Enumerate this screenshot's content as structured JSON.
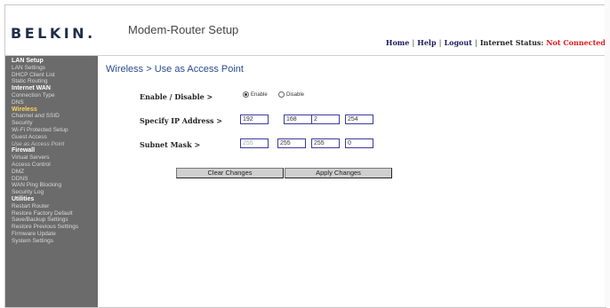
{
  "header": {
    "logo": "BELKIN.",
    "title": "Modem-Router Setup",
    "links": [
      "Home",
      "Help",
      "Logout"
    ],
    "status_label": "Internet Status:",
    "status_value": "Not Connected",
    "status_color": "#e01818"
  },
  "sidebar": {
    "groups": [
      {
        "heading": "LAN Setup",
        "items": [
          "LAN Settings",
          "DHCP Client List",
          "Static Routing"
        ]
      },
      {
        "heading": "Internet WAN",
        "items": [
          "Connection Type",
          "DNS"
        ]
      },
      {
        "heading": "Wireless",
        "items": [
          "Channel and SSID",
          "Security",
          "Wi-Fi Protected Setup",
          "Guest Access",
          "Use as Access Point"
        ]
      },
      {
        "heading": "Firewall",
        "items": [
          "Virtual Servers",
          "Access Control",
          "DMZ",
          "DDNS",
          "WAN Ping Blocking",
          "Security Log"
        ]
      },
      {
        "heading": "Utilities",
        "items": [
          "Restart Router",
          "Restore Factory Default",
          "Save/Backup Settings",
          "Restore Previous Settings",
          "Firmware Update",
          "System Settings"
        ]
      }
    ]
  },
  "main": {
    "page_title": "Wireless > Use as Access Point",
    "enable_label": "Enable / Disable >",
    "enable_option": "Enable",
    "disable_option": "Disable",
    "selected": "Enable",
    "ip_label": "Specify IP Address  >",
    "ip": [
      "192",
      "168",
      "2",
      "254"
    ],
    "mask_label": "Subnet Mask >",
    "mask": [
      "255",
      "255",
      "255",
      "0"
    ],
    "clear_button": "Clear Changes",
    "apply_button": "Apply Changes"
  }
}
